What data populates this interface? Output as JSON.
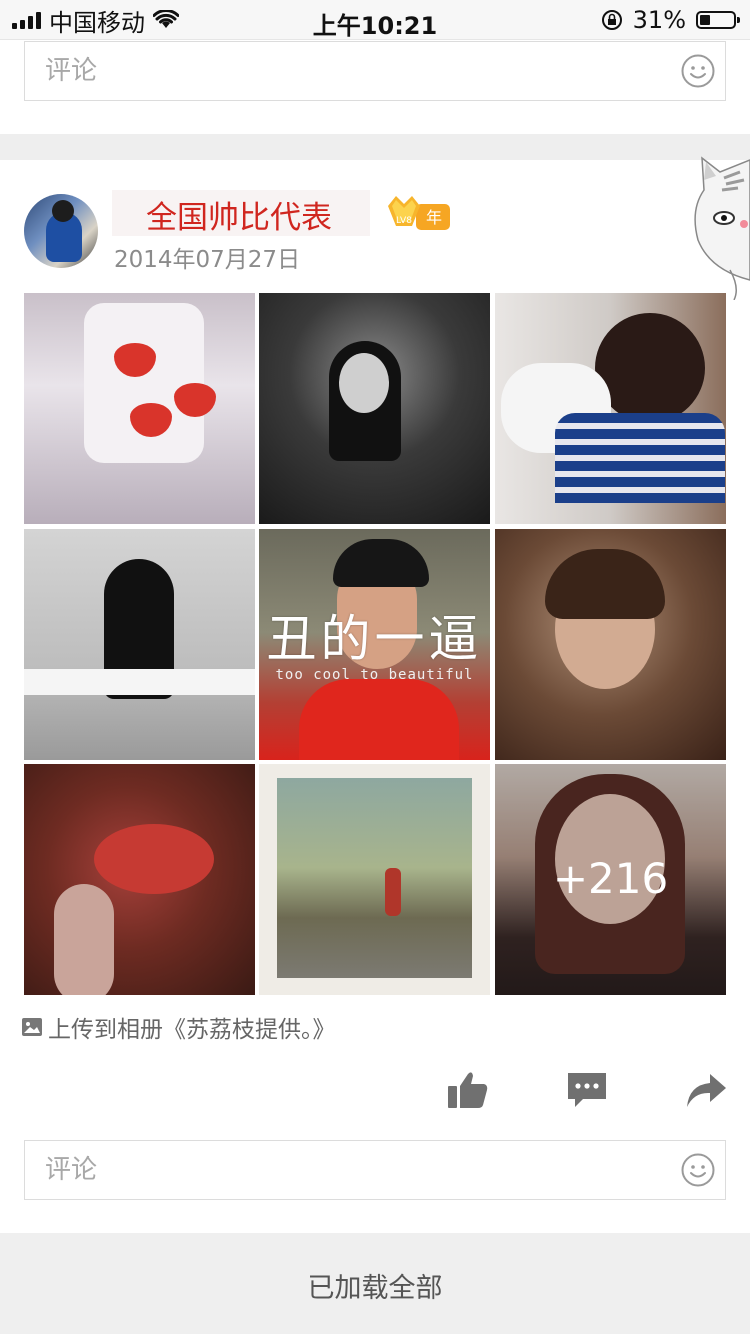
{
  "status_bar": {
    "carrier": "中国移动",
    "time": "上午10:21",
    "battery": "31%",
    "battery_level": 0.31
  },
  "comment_box_top": {
    "placeholder": "评论"
  },
  "post": {
    "username": "全国帅比代表",
    "badge": {
      "level": "LV8",
      "label": "年"
    },
    "date": "2014年07月27日",
    "photos": [
      {
        "name": "photo-1"
      },
      {
        "name": "photo-2"
      },
      {
        "name": "photo-3"
      },
      {
        "name": "photo-4"
      },
      {
        "name": "photo-5",
        "overlay_text": "丑的一逼",
        "overlay_subtext": "too cool to beautiful"
      },
      {
        "name": "photo-6"
      },
      {
        "name": "photo-7"
      },
      {
        "name": "photo-8"
      },
      {
        "name": "photo-9",
        "more_count": "+216"
      }
    ],
    "upload_info": "上传到相册《苏荔枝提供。》",
    "actions": {
      "like_icon": "thumbs-up-icon",
      "comment_icon": "comment-bubble-icon",
      "share_icon": "share-arrow-icon"
    },
    "comment_box": {
      "placeholder": "评论"
    }
  },
  "footer": {
    "loaded_text": "已加载全部"
  },
  "colors": {
    "username": "#d0261f",
    "icon_gray": "#707070",
    "page_bg": "#ffffff",
    "band_bg": "#eeeeee"
  }
}
